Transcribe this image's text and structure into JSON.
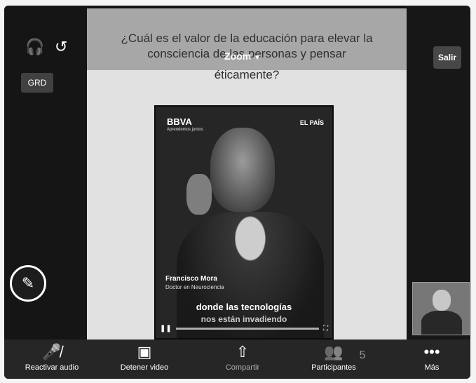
{
  "slide": {
    "question_line1": "¿Cuál es el valor de la educación para elevar la",
    "question_line2": "consciencia de las personas y pensar",
    "question_line3": "éticamente?"
  },
  "zoom": {
    "label": "Zoom"
  },
  "video": {
    "brand": "BBVA",
    "brand_sub": "Aprendemos juntos",
    "publisher": "EL PAÍS",
    "speaker_name": "Francisco Mora",
    "speaker_role": "Doctor en Neurociencia",
    "subtitle_line1": "donde las tecnologías",
    "subtitle_line2": "nos están invadiendo"
  },
  "left_panel": {
    "grd_label": "GRD"
  },
  "right_panel": {
    "exit_label": "Salir"
  },
  "toolbar": {
    "unmute_label": "Reactivar audio",
    "start_video_label": "Detener video",
    "share_label": "Compartir",
    "participants_label": "Participantes",
    "participants_count": "5",
    "more_label": "Más"
  },
  "icons": {
    "headphones": "headphones-icon",
    "camera_switch": "camera-switch-icon",
    "pen": "pen-icon",
    "mic_muted": "mic-muted-icon",
    "video": "video-camera-icon",
    "share": "share-screen-icon",
    "participants": "participants-icon",
    "more": "more-icon"
  }
}
